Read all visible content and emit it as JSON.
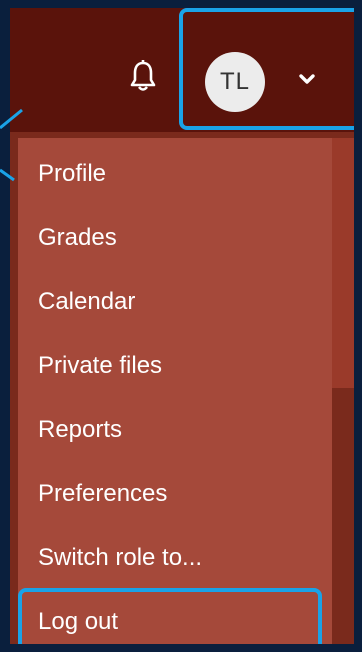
{
  "navbar": {
    "notification_icon": "bell-icon",
    "user_initials": "TL",
    "user_menu_toggle_icon": "chevron-down-icon"
  },
  "menu": {
    "items": [
      {
        "label": "Profile"
      },
      {
        "label": "Grades"
      },
      {
        "label": "Calendar"
      },
      {
        "label": "Private files"
      },
      {
        "label": "Reports"
      },
      {
        "label": "Preferences"
      },
      {
        "label": "Switch role to..."
      },
      {
        "label": "Log out"
      }
    ]
  },
  "colors": {
    "navbar_bg": "#5a130b",
    "dropdown_bg": "#a5493a",
    "highlight_border": "#1aa3e8",
    "frame": "#0a1f3d"
  }
}
